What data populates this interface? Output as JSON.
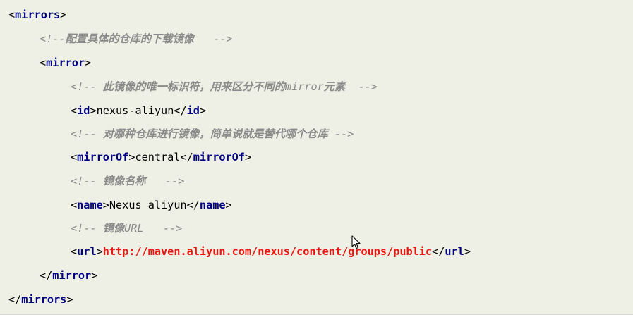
{
  "code": {
    "mirrors_tag": "mirrors",
    "mirror_tag": "mirror",
    "id_tag": "id",
    "mirrorof_tag": "mirrorOf",
    "name_tag": "name",
    "url_tag": "url",
    "open": "<",
    "close": ">",
    "open_end": "</",
    "comment_open": "<!--",
    "comment_close": "-->",
    "comment1_text": "配置具体的仓库的下载镜像",
    "comment2_text_a": "此镜像的唯一标识符，用来区分不同的",
    "comment2_text_b": "mirror",
    "comment2_text_c": "元素",
    "comment3_text": "对哪种仓库进行镜像，简单说就是替代哪个仓库",
    "comment4_text": "镜像名称",
    "comment5_text_a": "镜像",
    "comment5_text_b": "URL",
    "id_value": "nexus-aliyun",
    "mirrorof_value": "central",
    "name_value": "Nexus aliyun",
    "url_value": "http://maven.aliyun.com/nexus/content/groups/public"
  }
}
